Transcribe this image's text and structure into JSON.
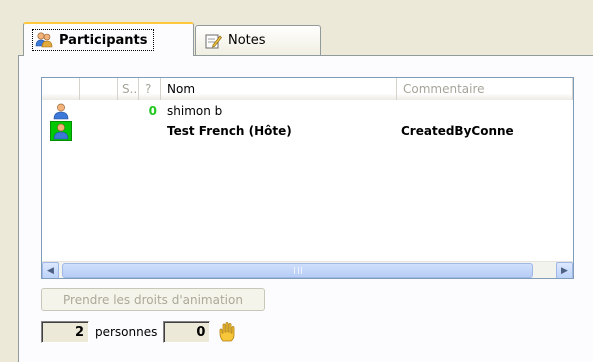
{
  "tabs": [
    {
      "label": "Participants",
      "icon": "participants-icon",
      "active": true
    },
    {
      "label": "Notes",
      "icon": "notes-icon",
      "active": false
    }
  ],
  "columns": [
    {
      "label": ""
    },
    {
      "label": ""
    },
    {
      "label": "S.."
    },
    {
      "label": "?"
    },
    {
      "label": "Nom"
    },
    {
      "label": "Commentaire"
    }
  ],
  "rows": [
    {
      "count": "0",
      "name": "shimon b",
      "comment": "",
      "host": false
    },
    {
      "count": "",
      "name": "Test French (Hôte)",
      "comment": "CreatedByConne",
      "host": true
    }
  ],
  "buttons": {
    "take_rights": "Prendre les droits d'animation"
  },
  "status": {
    "people_count": "2",
    "people_label": "personnes",
    "hands_count": "0"
  },
  "colors": {
    "count_green": "#1ec81e",
    "host_highlight": "#00c800",
    "tab_accent": "#ffc83c"
  }
}
